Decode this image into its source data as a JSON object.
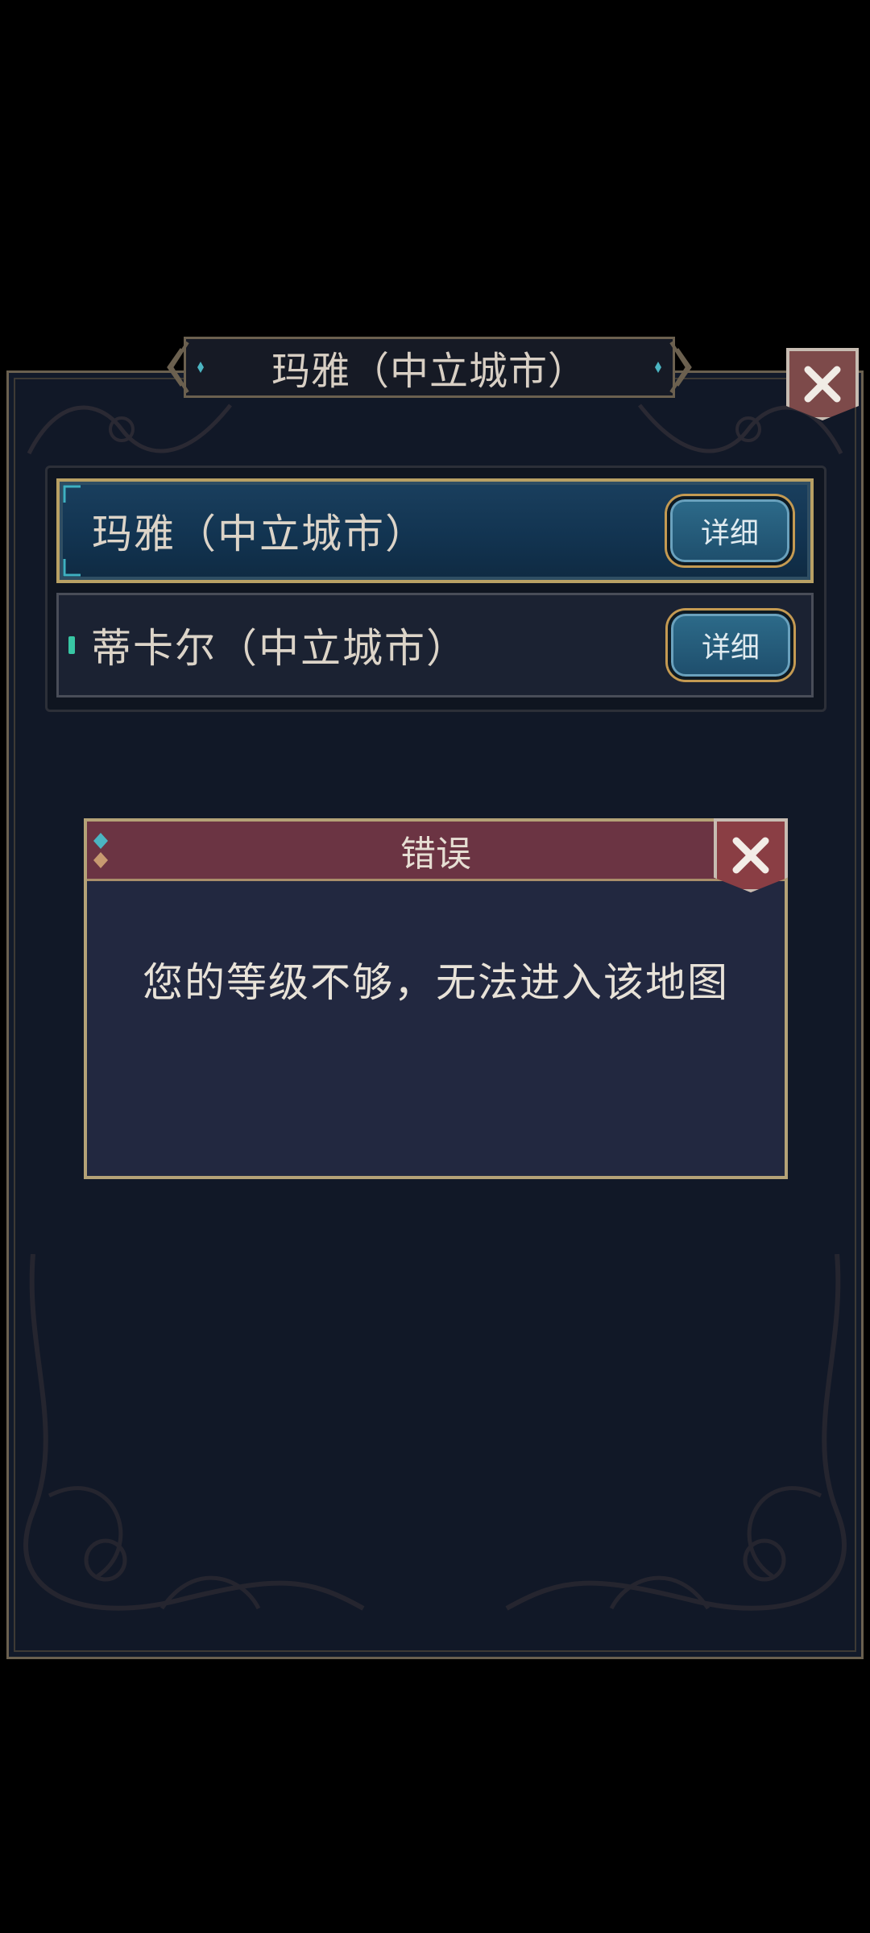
{
  "title_bar": {
    "title": "玛雅（中立城市）"
  },
  "map_list": [
    {
      "label": "玛雅（中立城市）",
      "detail_label": "详细",
      "selected": true
    },
    {
      "label": "蒂卡尔（中立城市）",
      "detail_label": "详细",
      "selected": false
    }
  ],
  "error_dialog": {
    "title": "错误",
    "message": "您的等级不够，无法进入该地图"
  },
  "colors": {
    "panel_bg": "#111827",
    "selected_item": "#123451",
    "dialog_header": "#6b3443",
    "dialog_body": "#222840",
    "gold_border": "#b8a064",
    "close_button": "#7d4a4a"
  }
}
